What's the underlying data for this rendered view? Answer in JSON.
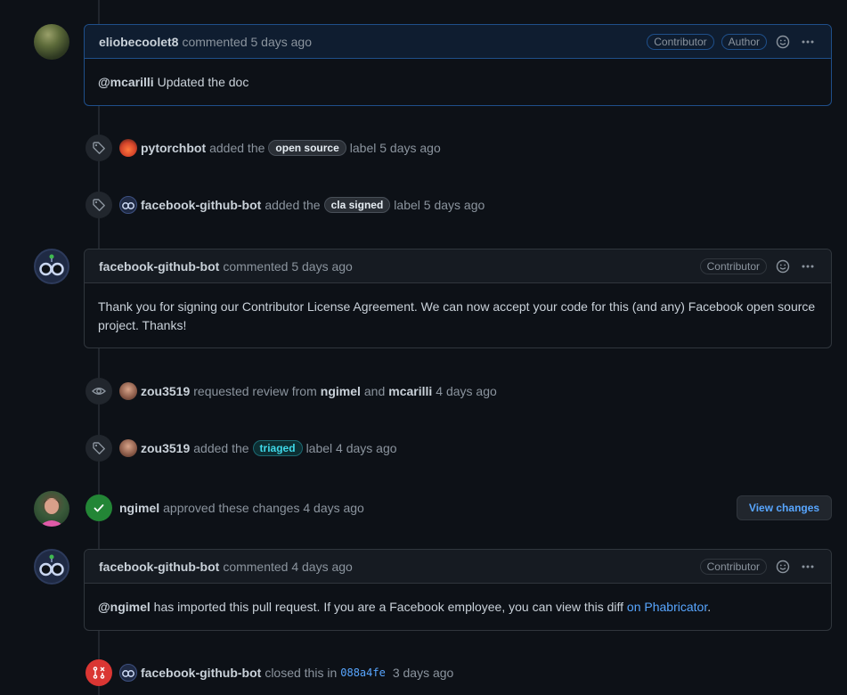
{
  "comments": [
    {
      "author": "eliobecoolet8",
      "meta": "commented 5 days ago",
      "badges": [
        "Contributor",
        "Author"
      ],
      "body_mention": "@mcarilli",
      "body_text": " Updated the doc"
    },
    {
      "author": "facebook-github-bot",
      "meta": "commented 5 days ago",
      "badges": [
        "Contributor"
      ],
      "body_text": "Thank you for signing our Contributor License Agreement. We can now accept your code for this (and any) Facebook open source project. Thanks!"
    },
    {
      "author": "facebook-github-bot",
      "meta": "commented 4 days ago",
      "badges": [
        "Contributor"
      ],
      "body_mention": "@ngimel",
      "body_text": " has imported this pull request. If you are a Facebook employee, you can view this diff ",
      "body_link": "on Phabricator",
      "body_end": "."
    }
  ],
  "events": {
    "label1": {
      "actor": "pytorchbot",
      "pre": "added the",
      "label": "open source",
      "post": "label 5 days ago"
    },
    "label2": {
      "actor": "facebook-github-bot",
      "pre": "added the",
      "label": "cla signed",
      "post": "label 5 days ago"
    },
    "review_request": {
      "actor": "zou3519",
      "pre": "requested review from",
      "reviewer1": "ngimel",
      "and": "and",
      "reviewer2": "mcarilli",
      "post": "4 days ago"
    },
    "label3": {
      "actor": "zou3519",
      "pre": "added the",
      "label": "triaged",
      "post": "label 4 days ago"
    },
    "approved": {
      "actor": "ngimel",
      "text": "approved these changes 4 days ago",
      "button": "View changes"
    },
    "closed": {
      "actor": "facebook-github-bot",
      "pre": "closed this in",
      "sha": "088a4fe",
      "post": "3 days ago"
    }
  },
  "icons": {
    "tag": "tag-icon",
    "eye": "eye-icon",
    "check": "check-icon",
    "merge": "git-pull-request-closed-icon",
    "smiley": "smiley-icon",
    "kebab": "kebab-horizontal-icon"
  },
  "colors": {
    "background": "#0d1117",
    "link": "#58a6ff",
    "approved": "#238636",
    "closed": "#da3633",
    "author_border": "#1f4f8a"
  }
}
